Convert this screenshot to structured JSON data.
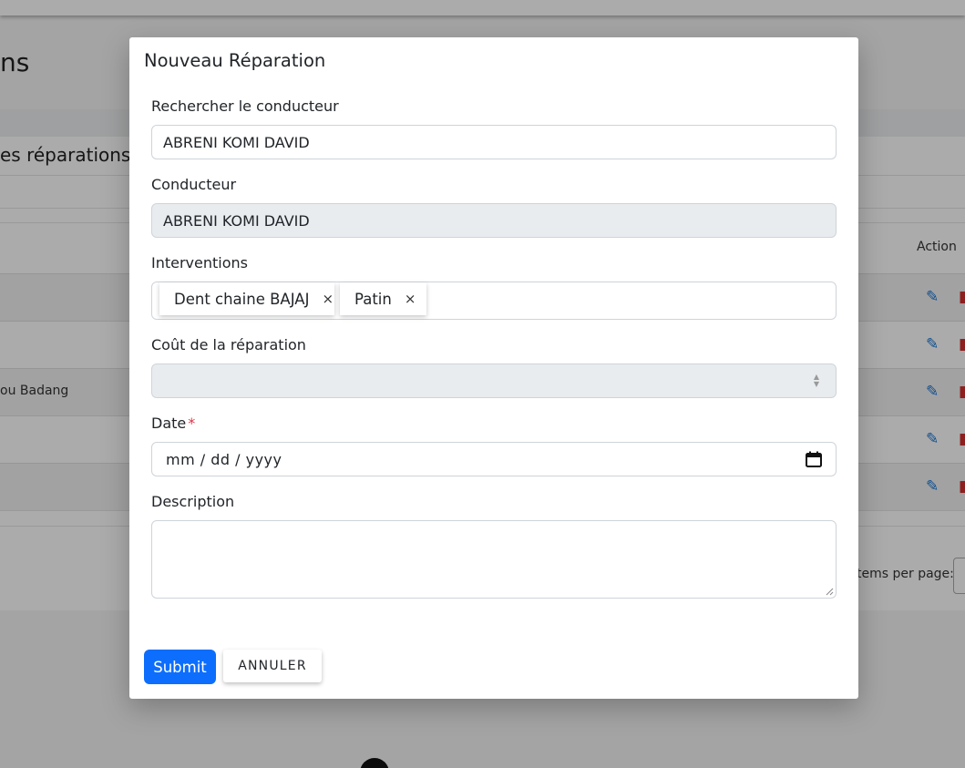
{
  "background": {
    "page_title_fragment": "ns",
    "card_title_fragment": "es réparations",
    "action_header": "Action",
    "row_text_fragment": "ou Badang",
    "items_per_page_fragment": "tems per page:",
    "edit_icon": "pencil-icon",
    "delete_icon": "trash-icon"
  },
  "modal": {
    "title": "Nouveau Réparation",
    "search_driver": {
      "label": "Rechercher le conducteur",
      "value": "ABRENI KOMI DAVID"
    },
    "driver": {
      "label": "Conducteur",
      "value": "ABRENI KOMI DAVID"
    },
    "interventions": {
      "label": "Interventions",
      "chips": [
        "Dent chaine BAJAJ",
        "Patin"
      ],
      "remove_symbol": "×"
    },
    "cost": {
      "label": "Coût de la réparation",
      "value": ""
    },
    "date": {
      "label": "Date",
      "required_mark": "*",
      "placeholder": "mm / dd / yyyy"
    },
    "description": {
      "label": "Description",
      "value": ""
    },
    "buttons": {
      "submit": "Submit",
      "cancel": "ANNULER"
    }
  },
  "colors": {
    "primary": "#0d6efd",
    "required": "#dc3545",
    "edit": "#1976d2",
    "delete": "#d32f2f"
  }
}
